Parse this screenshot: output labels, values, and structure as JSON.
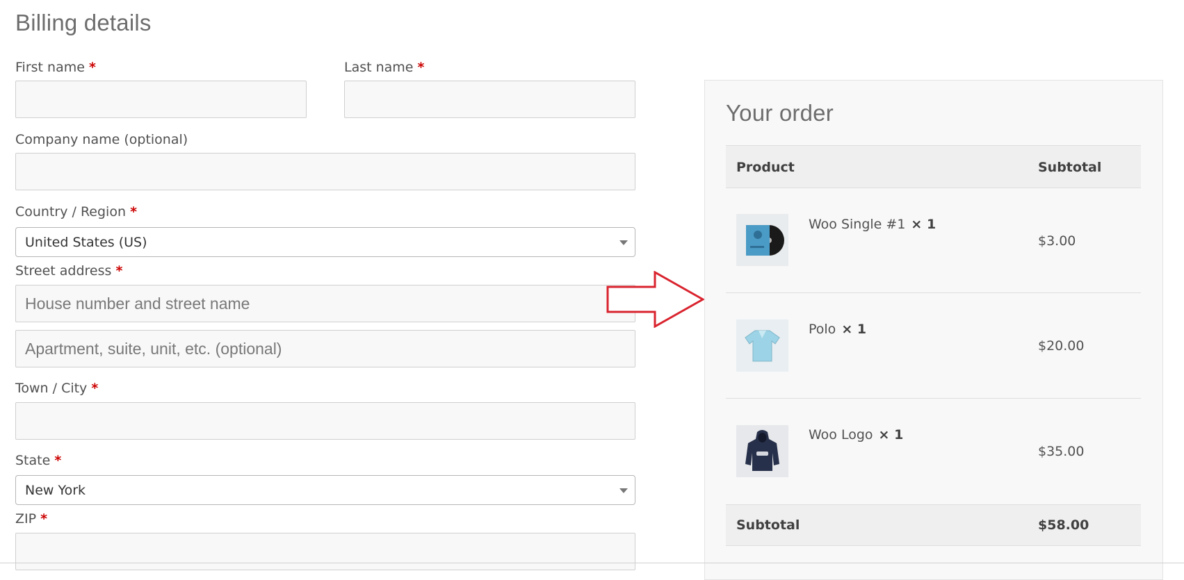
{
  "billing": {
    "title": "Billing details",
    "required_mark": "*",
    "first_name_label": "First name",
    "last_name_label": "Last name",
    "company_label": "Company name (optional)",
    "country_label": "Country / Region",
    "country_value": "United States (US)",
    "street_label": "Street address",
    "street_placeholder_1": "House number and street name",
    "street_placeholder_2": "Apartment, suite, unit, etc. (optional)",
    "city_label": "Town / City",
    "state_label": "State",
    "state_value": "New York",
    "zip_label": "ZIP"
  },
  "order": {
    "title": "Your order",
    "col_product": "Product",
    "col_subtotal": "Subtotal",
    "items": [
      {
        "name": "Woo Single #1",
        "qty": "× 1",
        "price": "$3.00",
        "icon": "vinyl-record-thumbnail"
      },
      {
        "name": "Polo",
        "qty": "× 1",
        "price": "$20.00",
        "icon": "polo-shirt-thumbnail"
      },
      {
        "name": "Woo Logo",
        "qty": "× 1",
        "price": "$35.00",
        "icon": "hoodie-thumbnail"
      }
    ],
    "subtotal_label": "Subtotal",
    "subtotal_value": "$58.00"
  },
  "annotation": {
    "arrow_color": "#d9232e",
    "icon": "right-arrow-annotation"
  }
}
